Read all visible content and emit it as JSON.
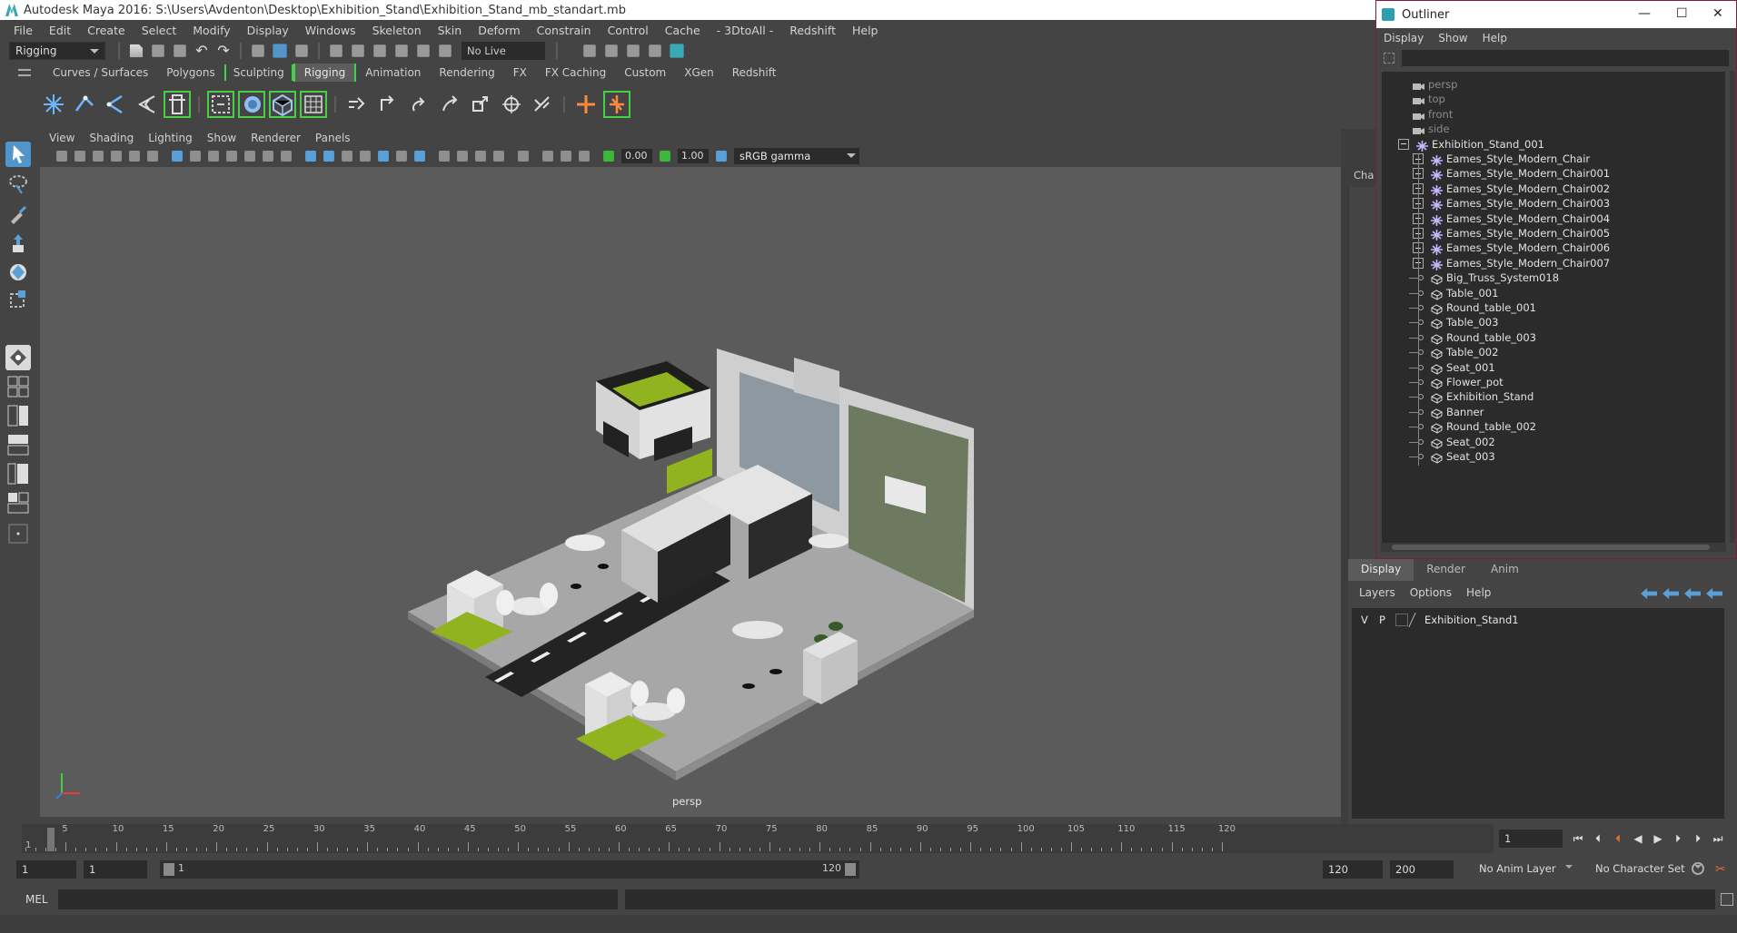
{
  "window": {
    "title": "Autodesk Maya 2016: S:\\Users\\Avdenton\\Desktop\\Exhibition_Stand\\Exhibition_Stand_mb_standart.mb"
  },
  "menubar": [
    "File",
    "Edit",
    "Create",
    "Select",
    "Modify",
    "Display",
    "Windows",
    "Skeleton",
    "Skin",
    "Deform",
    "Constrain",
    "Control",
    "Cache",
    "- 3DtoAll -",
    "Redshift",
    "Help"
  ],
  "statusline": {
    "mode": "Rigging",
    "live_surface": "No Live Surface"
  },
  "shelf_tabs": [
    "Curves / Surfaces",
    "Polygons",
    "Sculpting",
    "Rigging",
    "Animation",
    "Rendering",
    "FX",
    "FX Caching",
    "Custom",
    "XGen",
    "Redshift"
  ],
  "shelf_active_tab": "Rigging",
  "panel": {
    "menus": [
      "View",
      "Shading",
      "Lighting",
      "Show",
      "Renderer",
      "Panels"
    ],
    "exposure": "0.00",
    "gamma": "1.00",
    "color_space": "sRGB gamma",
    "camera_label": "persp"
  },
  "right_strip_label": "Cha",
  "timeslider": {
    "ticks": [
      "5",
      "10",
      "15",
      "20",
      "25",
      "30",
      "35",
      "40",
      "45",
      "50",
      "55",
      "60",
      "65",
      "70",
      "75",
      "80",
      "85",
      "90",
      "95",
      "100",
      "105",
      "110",
      "115",
      "120"
    ],
    "start_marker": "1",
    "current_frame": "1"
  },
  "rangebar": {
    "start": "1",
    "inner_start": "1",
    "range_start_label": "1",
    "range_end_label": "120",
    "end": "120",
    "max_end": "200",
    "anim_layer": "No Anim Layer",
    "character_set": "No Character Set"
  },
  "cmdline": {
    "label": "MEL"
  },
  "outliner": {
    "title": "Outliner",
    "menus": [
      "Display",
      "Show",
      "Help"
    ],
    "cameras": [
      "persp",
      "top",
      "front",
      "side"
    ],
    "root": "Exhibition_Stand_001",
    "groups": [
      "Eames_Style_Modern_Chair",
      "Eames_Style_Modern_Chair001",
      "Eames_Style_Modern_Chair002",
      "Eames_Style_Modern_Chair003",
      "Eames_Style_Modern_Chair004",
      "Eames_Style_Modern_Chair005",
      "Eames_Style_Modern_Chair006",
      "Eames_Style_Modern_Chair007"
    ],
    "meshes": [
      "Big_Truss_System018",
      "Table_001",
      "Round_table_001",
      "Table_003",
      "Round_table_003",
      "Table_002",
      "Seat_001",
      "Flower_pot",
      "Exhibition_Stand",
      "Banner",
      "Round_table_002",
      "Seat_002",
      "Seat_003"
    ]
  },
  "layers": {
    "tabs": [
      "Display",
      "Render",
      "Anim"
    ],
    "menus": [
      "Layers",
      "Options",
      "Help"
    ],
    "rows": [
      {
        "v": "V",
        "p": "P",
        "name": "Exhibition_Stand1"
      }
    ]
  },
  "colors": {
    "accent_blue": "#5295ca",
    "shelf_highlight": "#46d046",
    "outliner_border": "#7b1e3a"
  }
}
